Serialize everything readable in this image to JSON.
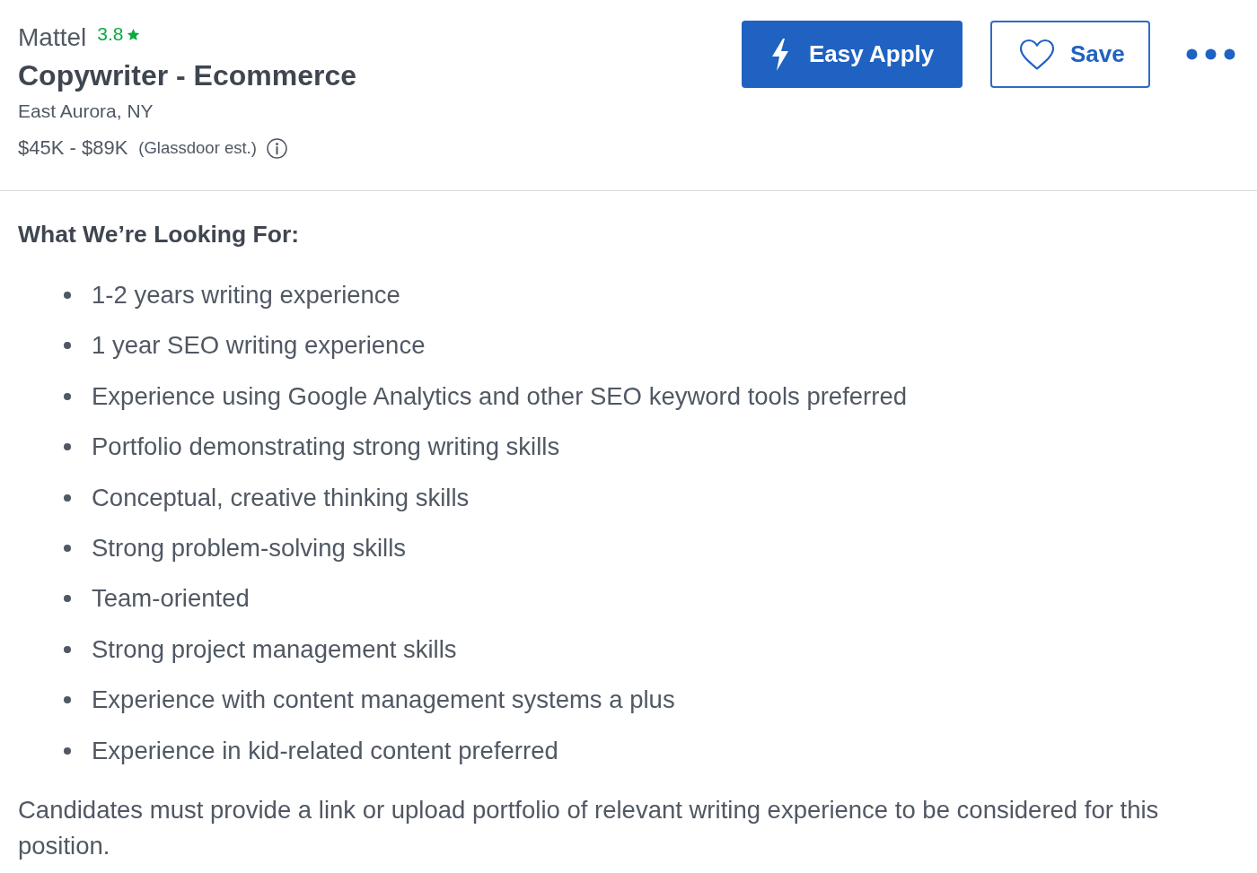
{
  "header": {
    "company": "Mattel",
    "rating": "3.8",
    "title": "Copywriter - Ecommerce",
    "location": "East Aurora, NY",
    "salary": "$45K - $89K",
    "salary_note": "(Glassdoor est.)"
  },
  "actions": [
    {
      "kind": "apply",
      "label": "Easy Apply"
    },
    {
      "kind": "save",
      "label": "Save"
    },
    {
      "kind": "more"
    }
  ],
  "description": {
    "heading": "What We’re Looking For:",
    "bullets": [
      "1-2 years writing experience",
      "1 year SEO writing experience",
      "Experience using Google Analytics and other SEO keyword tools preferred",
      "Portfolio demonstrating strong writing skills",
      "Conceptual, creative thinking skills",
      "Strong problem-solving skills",
      "Team-oriented",
      "Strong project management skills",
      "Experience with content management systems a plus",
      "Experience in kid-related content preferred"
    ],
    "paragraph": "Candidates must provide a link or upload portfolio of relevant writing experience to be considered for this position."
  }
}
